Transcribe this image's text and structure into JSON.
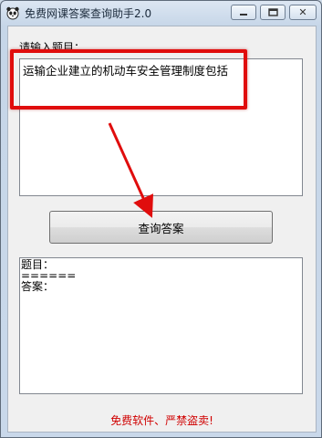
{
  "window": {
    "title": "免费网课答案查询助手2.0",
    "controls": {
      "minimize": "minimize",
      "maximize": "maximize",
      "close": "✕"
    }
  },
  "question": {
    "label": "请输入题目：",
    "value": "运输企业建立的机动车安全管理制度包括"
  },
  "query_button": {
    "label": "查询答案"
  },
  "answer": {
    "lines": [
      "题目：",
      "======",
      "答案："
    ]
  },
  "footer": {
    "note": "免费软件、严禁盗卖!"
  },
  "colors": {
    "annotation_red": "#e00d0d",
    "footer_red": "#d00000",
    "window_frame": "#c6d6e8"
  },
  "icons": {
    "app": "panda-icon",
    "minimize": "minimize-icon",
    "maximize": "maximize-icon",
    "close": "close-icon"
  }
}
